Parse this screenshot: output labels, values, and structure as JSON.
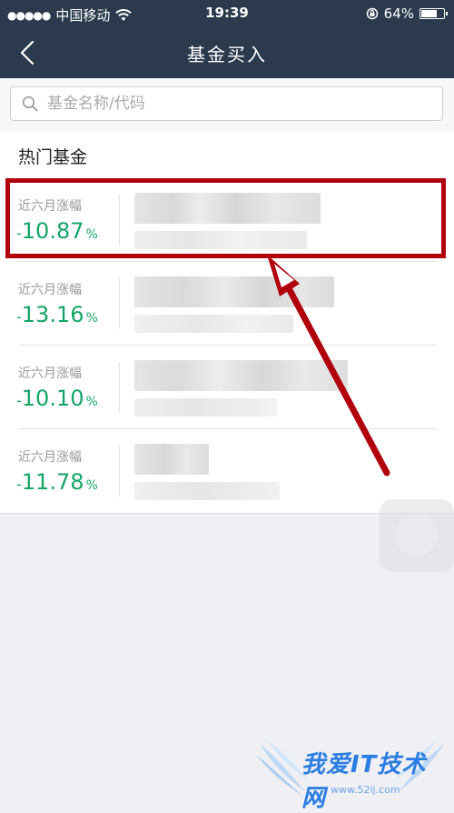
{
  "status_bar": {
    "signal_dots": "●●●●●",
    "carrier": "中国移动",
    "time": "19:39",
    "battery": "64%",
    "battery_level": 0.64
  },
  "nav": {
    "title": "基金买入",
    "back_icon": "chevron-left-icon"
  },
  "search": {
    "placeholder": "基金名称/代码",
    "value": ""
  },
  "section_title": "热门基金",
  "funds": [
    {
      "label": "近六月涨幅",
      "minus": "-",
      "value": "10.87",
      "unit": "%"
    },
    {
      "label": "近六月涨幅",
      "minus": "-",
      "value": "13.16",
      "unit": "%"
    },
    {
      "label": "近六月涨幅",
      "minus": "-",
      "value": "10.10",
      "unit": "%"
    },
    {
      "label": "近六月涨幅",
      "minus": "-",
      "value": "11.78",
      "unit": "%"
    }
  ],
  "watermark": {
    "text": "我爱IT技术网",
    "url": "www.52ij.com"
  },
  "colors": {
    "header": "#2b3a4c",
    "positive_green": "#16a569",
    "highlight_red": "#b0000b"
  }
}
